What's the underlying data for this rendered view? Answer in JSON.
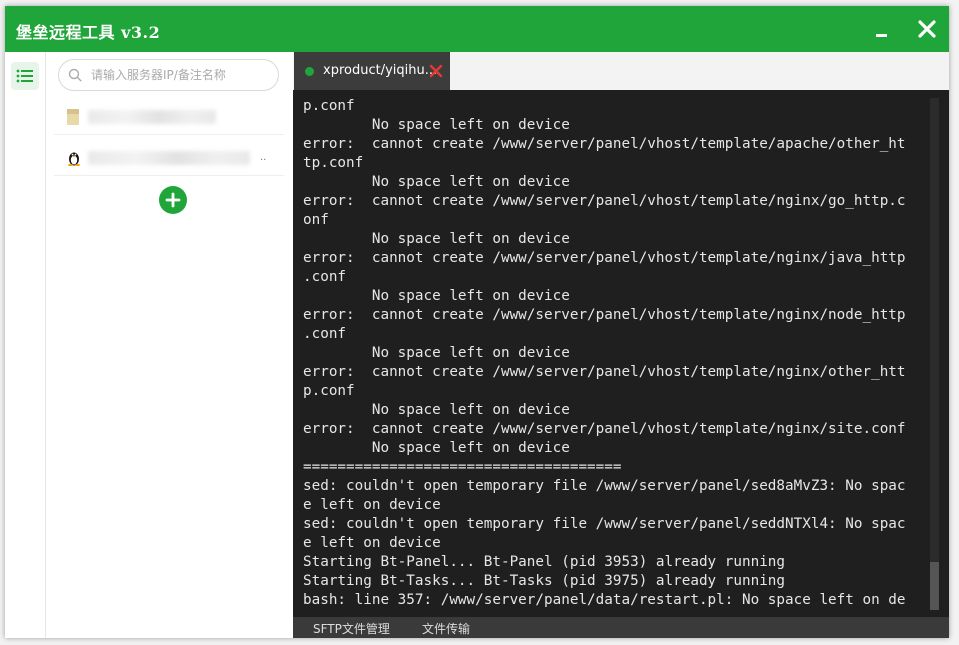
{
  "app": {
    "title": "堡垒远程工具 v3.2",
    "accent_color": "#20a53a",
    "minimize_icon": "minimize-icon",
    "close_icon": "close-icon"
  },
  "leftbar": {
    "menu_icon": "list-menu-icon"
  },
  "sidebar": {
    "search": {
      "placeholder": "请输入服务器IP/备注名称",
      "value": "",
      "icon": "search-icon"
    },
    "servers": [
      {
        "os_icon": "folder-icon",
        "label_visible": false
      },
      {
        "os_icon": "linux-penguin-icon",
        "label_visible": false,
        "suffix": ".."
      }
    ],
    "add_icon": "plus-icon"
  },
  "tabs": [
    {
      "label": "xproduct/yiqihu...",
      "status": "connected",
      "status_color": "#20a53a",
      "close_icon": "close-tab-icon"
    }
  ],
  "terminal": {
    "lines": [
      "p.conf",
      "        No space left on device",
      "error:  cannot create /www/server/panel/vhost/template/apache/other_ht",
      "tp.conf",
      "        No space left on device",
      "error:  cannot create /www/server/panel/vhost/template/nginx/go_http.c",
      "onf",
      "        No space left on device",
      "error:  cannot create /www/server/panel/vhost/template/nginx/java_http",
      ".conf",
      "        No space left on device",
      "error:  cannot create /www/server/panel/vhost/template/nginx/node_http",
      ".conf",
      "        No space left on device",
      "error:  cannot create /www/server/panel/vhost/template/nginx/other_htt",
      "p.conf",
      "        No space left on device",
      "error:  cannot create /www/server/panel/vhost/template/nginx/site.conf",
      "        No space left on device",
      "=====================================",
      "sed: couldn't open temporary file /www/server/panel/sed8aMvZ3: No spac",
      "e left on device",
      "sed: couldn't open temporary file /www/server/panel/seddNTXl4: No spac",
      "e left on device",
      "Starting Bt-Panel... Bt-Panel (pid 3953) already running",
      "Starting Bt-Tasks... Bt-Tasks (pid 3975) already running",
      "bash: line 357: /www/server/panel/data/restart.pl: No space left on de"
    ],
    "scroll_position": 0.91
  },
  "bottombar": {
    "sftp_label": "SFTP文件管理",
    "transfer_label": "文件传输"
  }
}
